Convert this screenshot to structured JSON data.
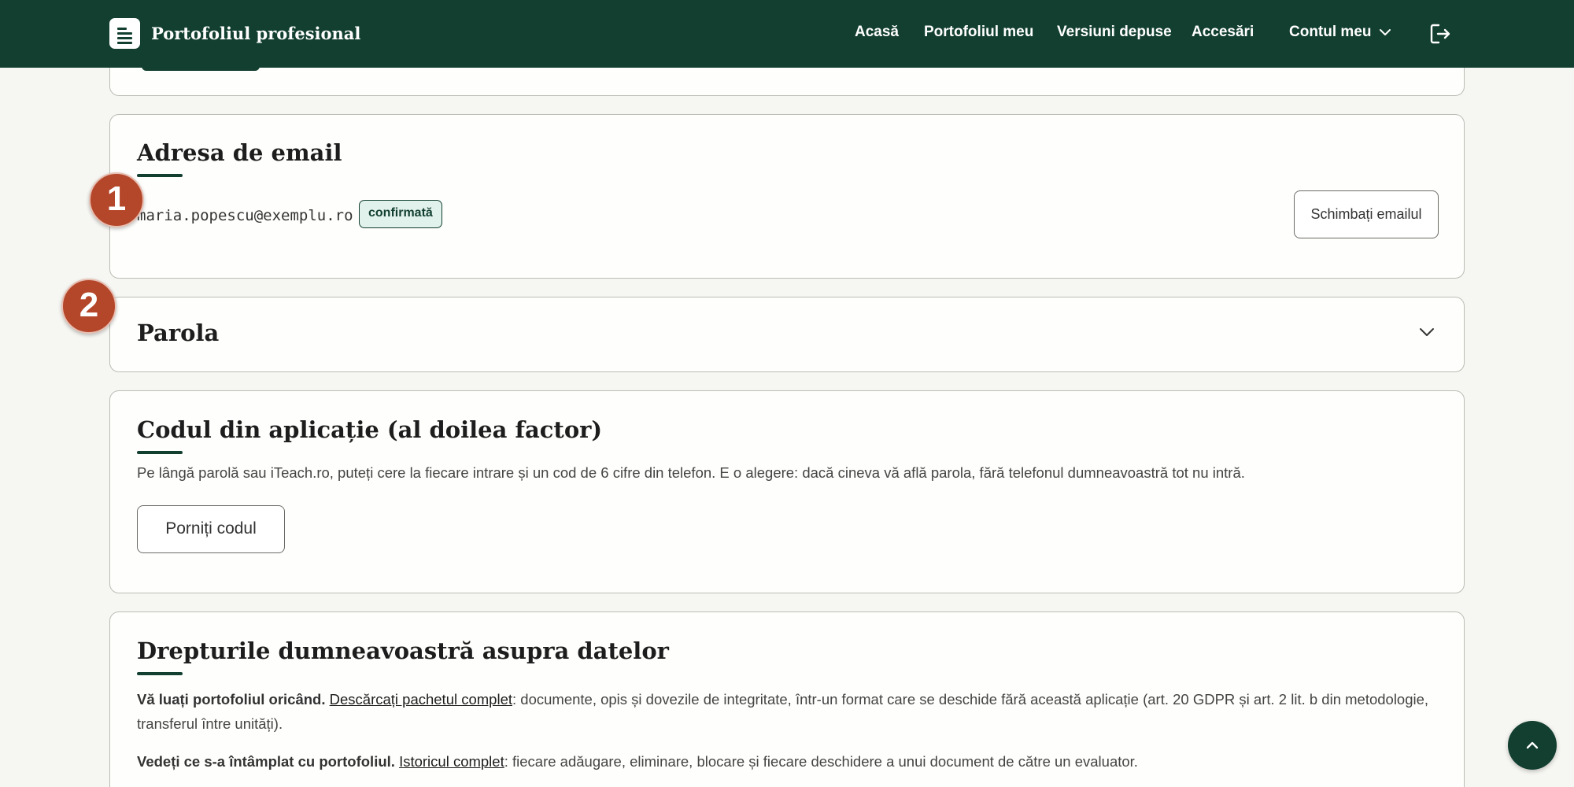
{
  "header": {
    "title": "Portofoliul profesional",
    "nav": [
      "Acasă",
      "Portofoliul meu",
      "Versiuni depuse",
      "Accesări"
    ],
    "account_label": "Contul meu"
  },
  "email_section": {
    "title": "Adresa de email",
    "email": "maria.popescu@exemplu.ro",
    "status": "confirmată",
    "change_label": "Schimbați emailul"
  },
  "password_section": {
    "title": "Parola"
  },
  "twofa_section": {
    "title": "Codul din aplicație (al doilea factor)",
    "description": "Pe lângă parolă sau iTeach.ro, puteți cere la fiecare intrare și un cod de 6 cifre din telefon. E o alegere: dacă cineva vă află parola, fără telefonul dumneavoastră tot nu intră.",
    "start_label": "Porniți codul"
  },
  "rights_section": {
    "title": "Drepturile dumneavoastră asupra datelor",
    "p1_bold": "Vă luați portofoliul oricând.",
    "p1_link": "Descărcați pachetul complet",
    "p1_rest": ": documente, opis și dovezile de integritate, într-un format care se deschide fără această aplicație (art. 20 GDPR și art. 2 lit. b din metodologie, transferul între unități).",
    "p2_bold": "Vedeți ce s-a întâmplat cu portofoliul.",
    "p2_link": "Istoricul complet",
    "p2_rest": ": fiecare adăugare, eliminare, blocare și fiecare deschidere a unui document de către un evaluator."
  },
  "markers": [
    "1",
    "2"
  ],
  "colors": {
    "header_bg": "#123f30",
    "accent": "#123f30",
    "badge_bg": "#e1f1ec",
    "marker": "#b4462a",
    "page_bg": "#f6f6f2"
  },
  "icons": [
    "document-icon",
    "chevron-down-icon",
    "logout-icon",
    "arrow-up-icon"
  ]
}
